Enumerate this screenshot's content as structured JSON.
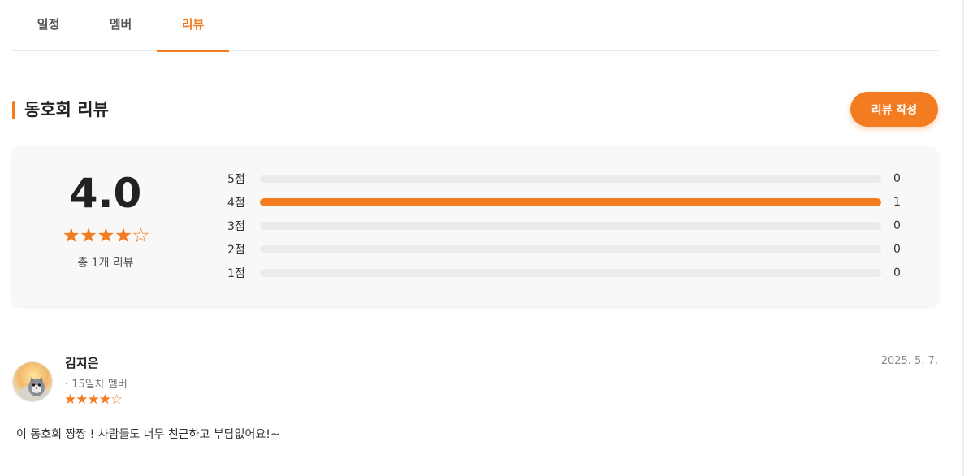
{
  "tabs": [
    {
      "label": "일정",
      "active": false
    },
    {
      "label": "멤버",
      "active": false
    },
    {
      "label": "리뷰",
      "active": true
    }
  ],
  "section": {
    "title": "동호회 리뷰",
    "write_button": "리뷰 작성"
  },
  "summary": {
    "average": "4.0",
    "stars": "★★★★☆",
    "total": "총 1개 리뷰",
    "distribution": [
      {
        "label": "5점",
        "count": "0",
        "fraction": 0
      },
      {
        "label": "4점",
        "count": "1",
        "fraction": 1
      },
      {
        "label": "3점",
        "count": "0",
        "fraction": 0
      },
      {
        "label": "2점",
        "count": "0",
        "fraction": 0
      },
      {
        "label": "1점",
        "count": "0",
        "fraction": 0
      }
    ]
  },
  "reviews": [
    {
      "name": "김지은",
      "meta": "· 15일차 멤버",
      "stars": "★★★★☆",
      "date": "2025. 5. 7.",
      "text": "이 동호회 짱짱 ! 사람들도 너무 친근하고 부담없어요!~"
    }
  ],
  "colors": {
    "accent": "#f47c20",
    "track": "#ebebeb",
    "card": "#f8f8f8"
  }
}
